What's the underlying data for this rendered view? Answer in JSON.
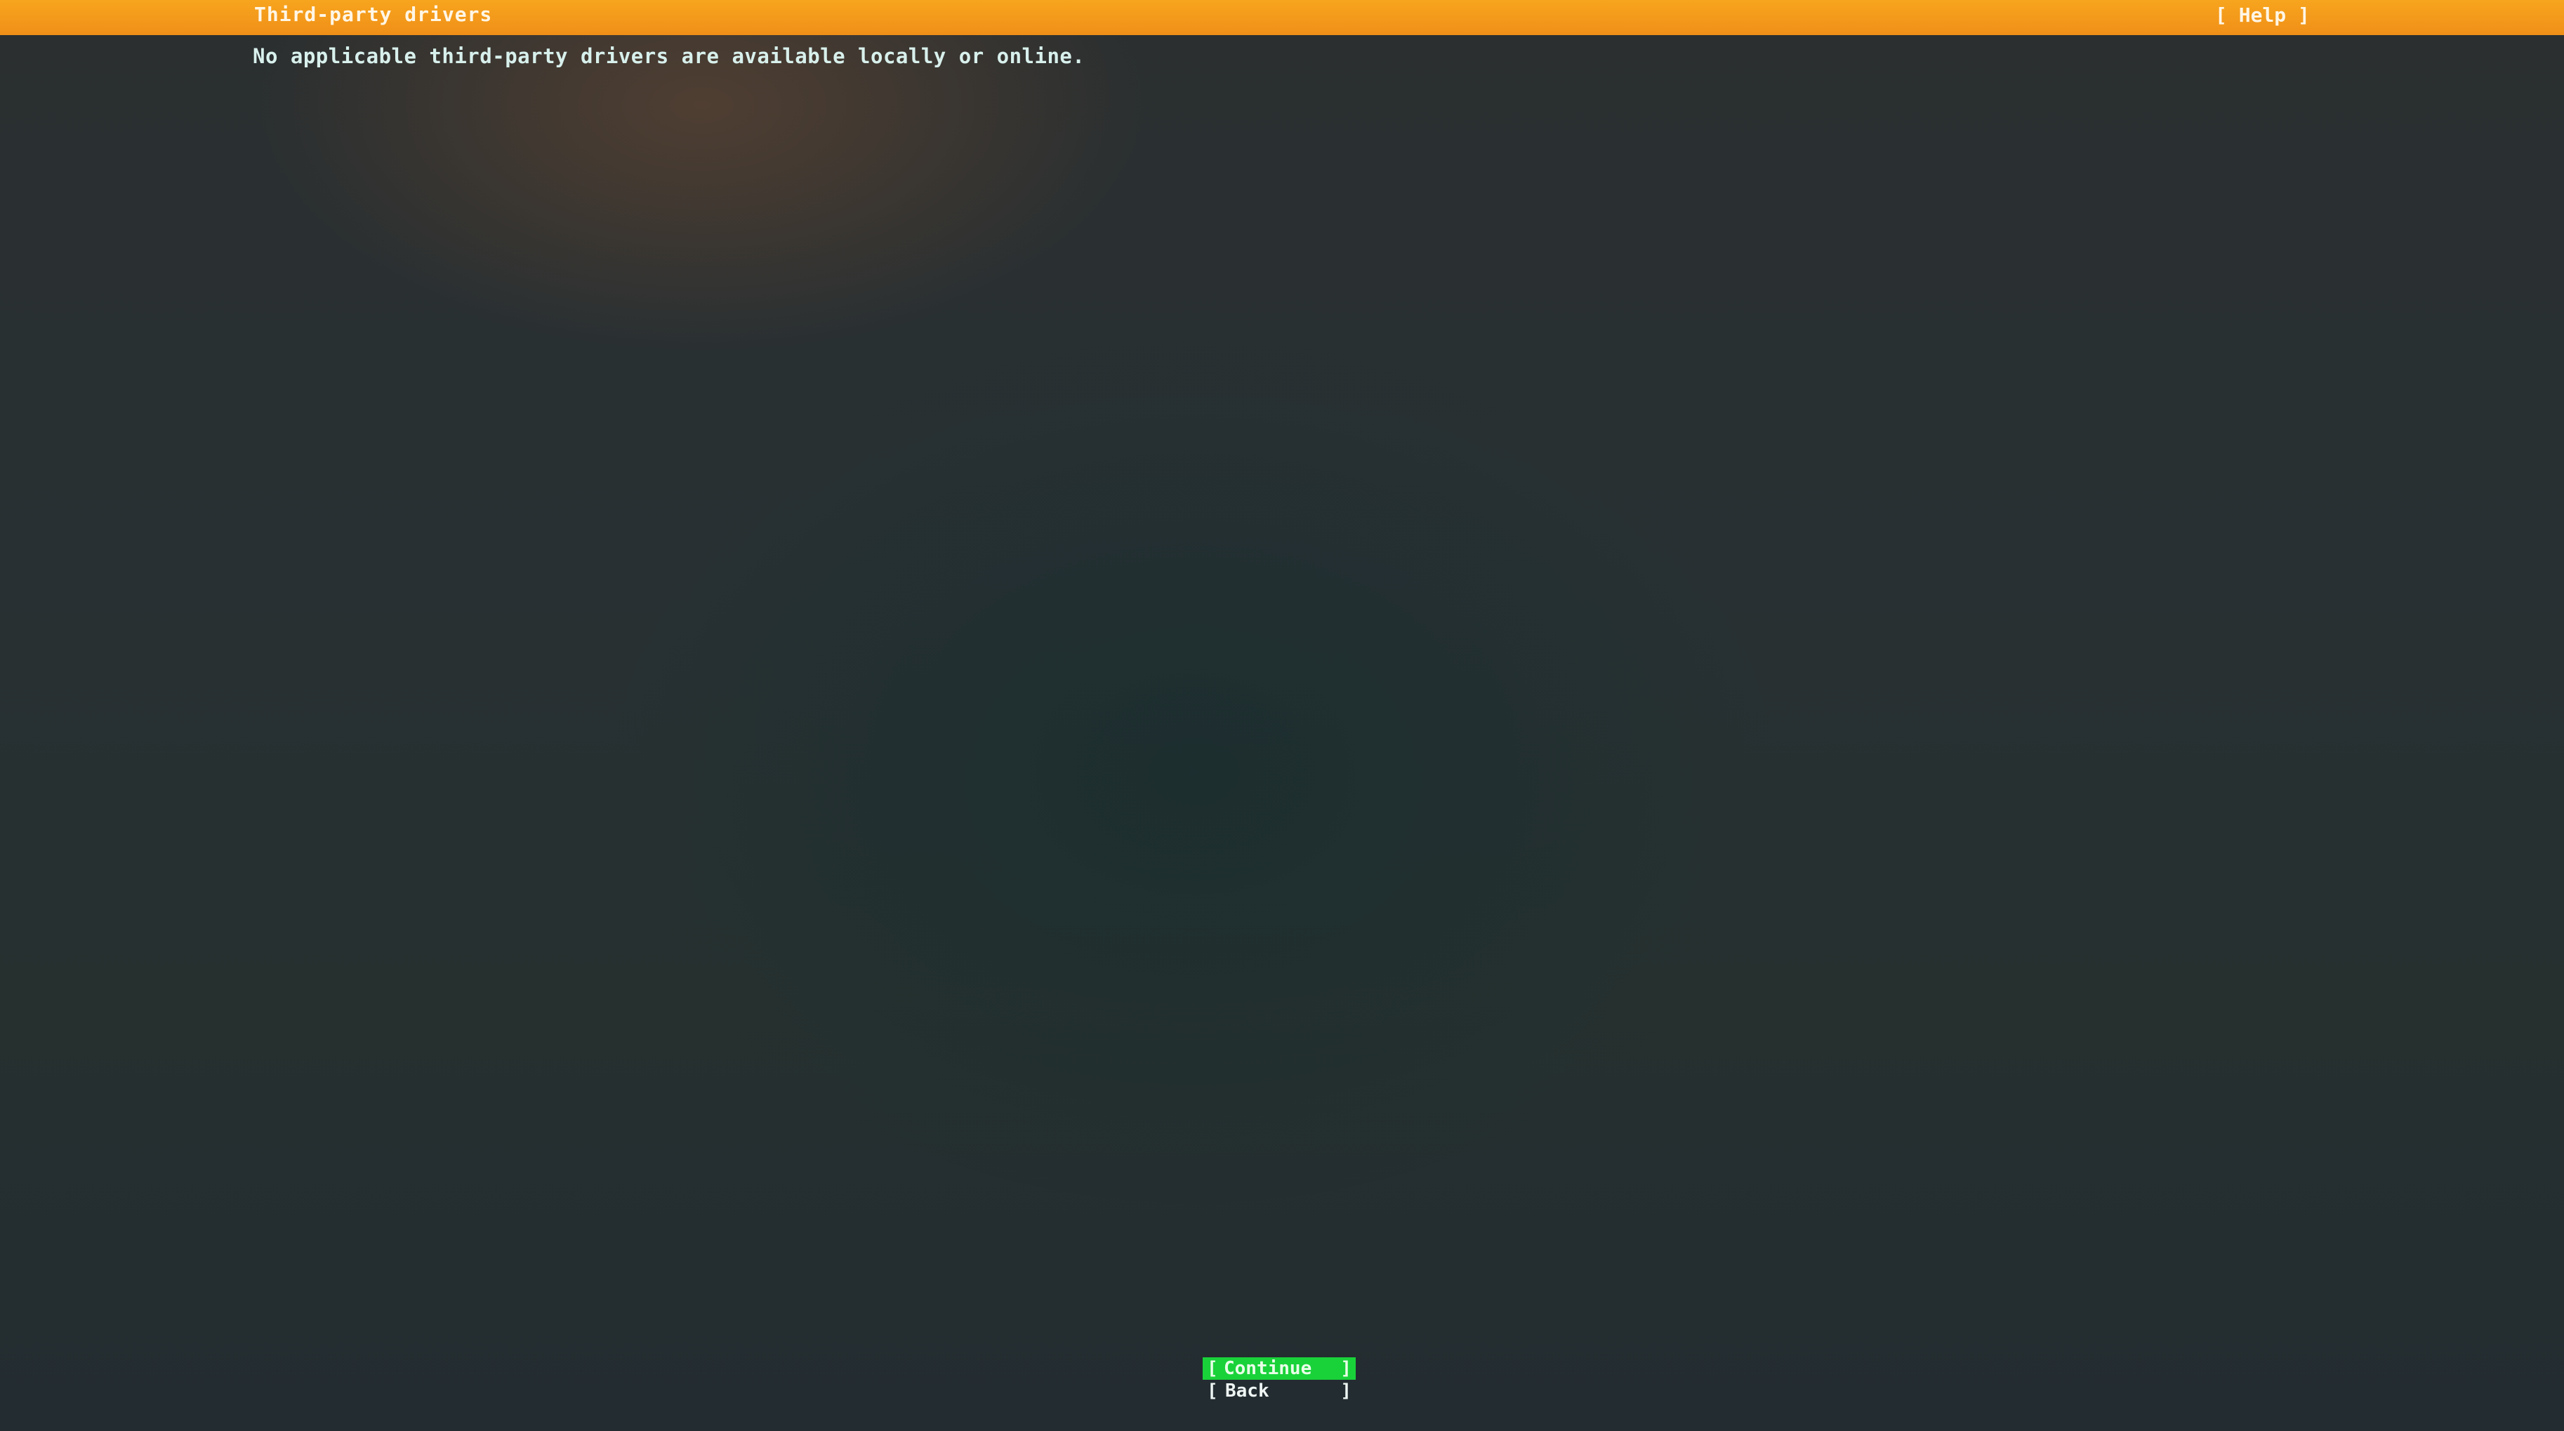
{
  "header": {
    "title": "Third-party drivers",
    "help_label": "[ Help ]",
    "color": "#f7a51e"
  },
  "main": {
    "message": "No applicable third-party drivers are available locally or online."
  },
  "buttons": {
    "left_bracket": "[",
    "right_bracket": "]",
    "continue_label": "Continue",
    "back_label": "Back",
    "focus_color": "#19d23a"
  }
}
